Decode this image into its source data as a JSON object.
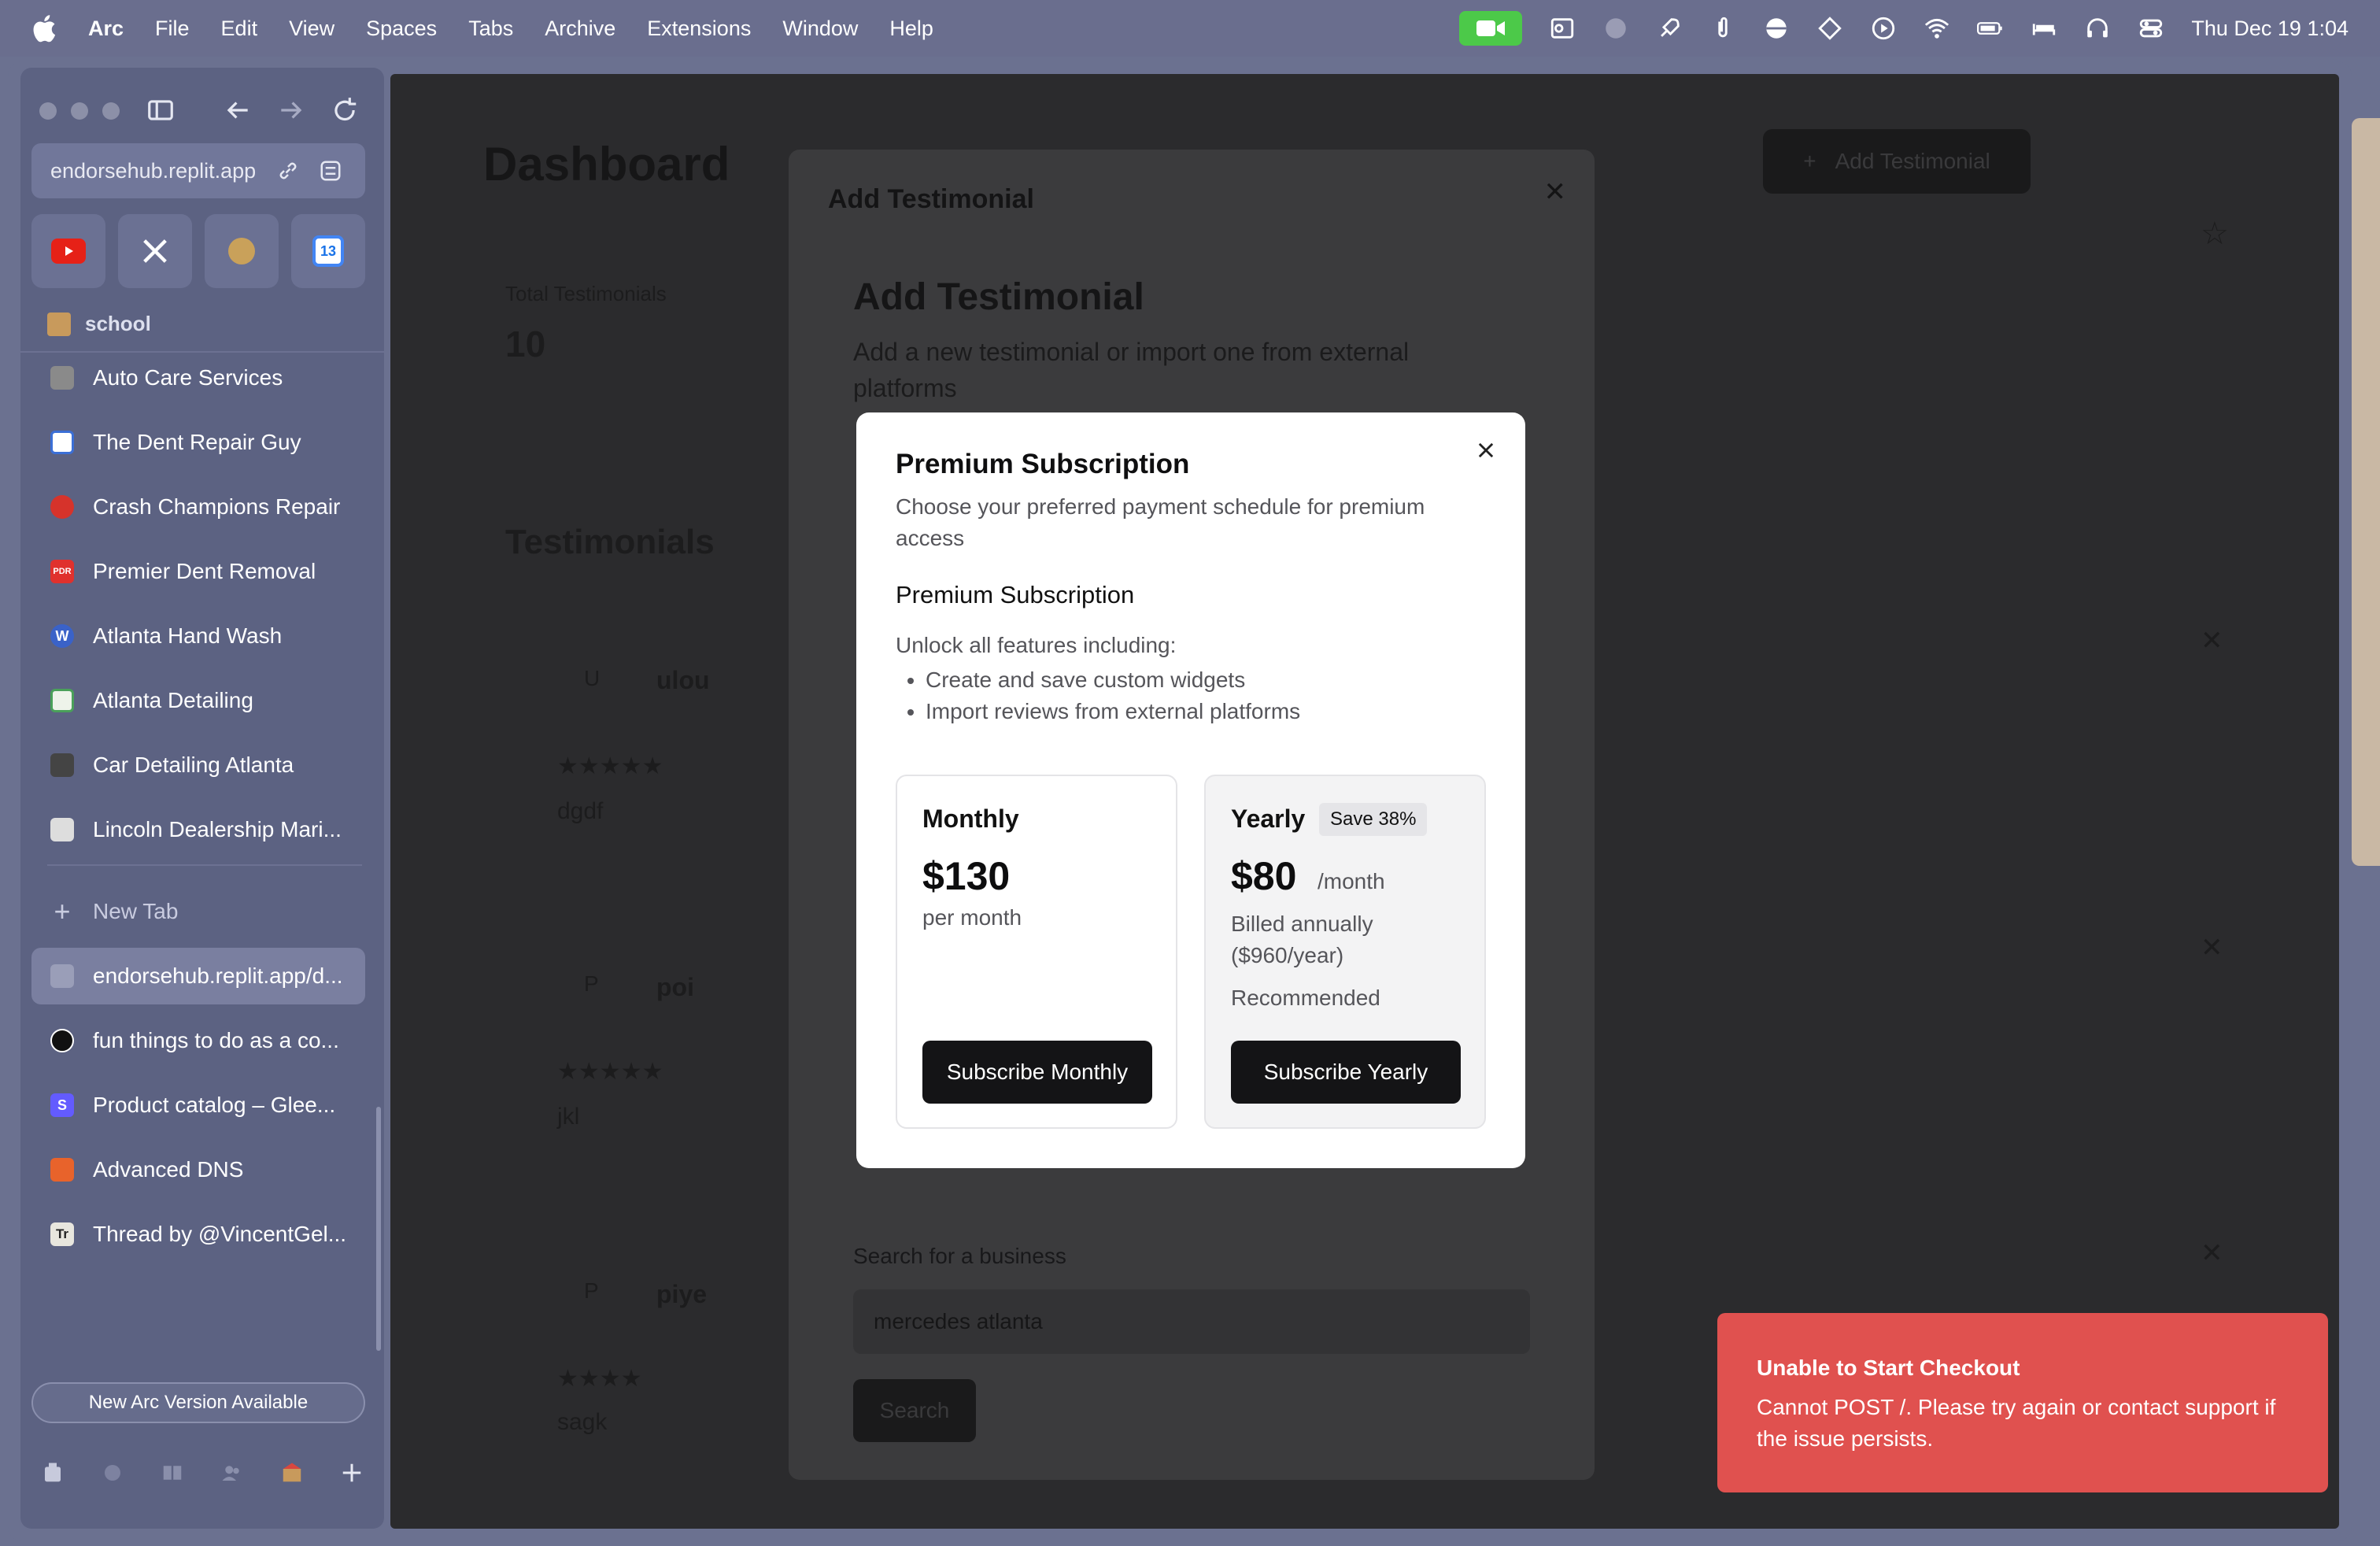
{
  "menubar": {
    "app": "Arc",
    "items": [
      "File",
      "Edit",
      "View",
      "Spaces",
      "Tabs",
      "Archive",
      "Extensions",
      "Window",
      "Help"
    ],
    "clock": "Thu Dec 19  1:04"
  },
  "sidebar": {
    "url": "endorsehub.replit.app",
    "space_name": "school",
    "pinned_tabs": [
      {
        "label": "Auto Care Services",
        "icon": "box-icon",
        "color": "#8a8a8a"
      },
      {
        "label": "The Dent Repair Guy",
        "icon": "grid-icon",
        "color": "#3b6fd6"
      },
      {
        "label": "Crash Champions Repair",
        "icon": "crash-icon",
        "color": "#d6332b"
      },
      {
        "label": "Premier Dent Removal",
        "icon": "pdr-icon",
        "color": "#e0312d"
      },
      {
        "label": "Atlanta Hand Wash",
        "icon": "wordpress-icon",
        "color": "#3a62c8"
      },
      {
        "label": "Atlanta Detailing",
        "icon": "car-icon",
        "color": "#4aa05a"
      },
      {
        "label": "Car Detailing Atlanta",
        "icon": "photo-icon",
        "color": "#444"
      },
      {
        "label": "Lincoln Dealership Mari...",
        "icon": "lincoln-icon",
        "color": "#ddd"
      }
    ],
    "new_tab_label": "New Tab",
    "tabs": [
      {
        "label": "endorsehub.replit.app/d...",
        "icon": "page-icon",
        "color": "#9a9eb8"
      },
      {
        "label": "fun things to do as a co...",
        "icon": "openai-icon",
        "color": "#111"
      },
      {
        "label": "Product catalog – Glee...",
        "icon": "stripe-icon",
        "color": "#635bff",
        "letter": "S"
      },
      {
        "label": "Advanced DNS",
        "icon": "namecheap-icon",
        "color": "#e8632b"
      },
      {
        "label": "Thread by @VincentGel...",
        "icon": "threadreader-icon",
        "color": "#e8e6de",
        "letter": "Tr"
      }
    ],
    "update_banner": "New Arc Version Available"
  },
  "page": {
    "title": "Dashboard",
    "add_button": "Add Testimonial",
    "stat_label": "Total Testimonials",
    "stat_value": "10",
    "section_title": "Testimonials",
    "entries": [
      {
        "initial": "U",
        "name": "ulou",
        "text": "dgdf"
      },
      {
        "initial": "P",
        "name": "poi",
        "text": "jkl"
      },
      {
        "initial": "P",
        "name": "piye",
        "text": "sagk"
      }
    ]
  },
  "add_modal": {
    "header": "Add Testimonial",
    "title": "Add Testimonial",
    "description": "Add a new testimonial or import one from external platforms",
    "search_label": "Search for a business",
    "search_value": "mercedes atlanta",
    "search_button": "Search"
  },
  "premium": {
    "title": "Premium Subscription",
    "subtitle": "Choose your preferred payment schedule for premium access",
    "section_title": "Premium Subscription",
    "unlock_text": "Unlock all features including:",
    "features": [
      "Create and save custom widgets",
      "Import reviews from external platforms"
    ],
    "monthly": {
      "name": "Monthly",
      "price": "$130",
      "period": "per month",
      "button": "Subscribe Monthly"
    },
    "yearly": {
      "name": "Yearly",
      "badge": "Save 38%",
      "price": "$80",
      "period": "/month",
      "billing": "Billed annually ($960/year)",
      "recommended": "Recommended",
      "button": "Subscribe Yearly"
    }
  },
  "toast": {
    "title": "Unable to Start Checkout",
    "message": "Cannot POST /. Please try again or contact support if the issue persists.",
    "color": "#e0514f"
  }
}
